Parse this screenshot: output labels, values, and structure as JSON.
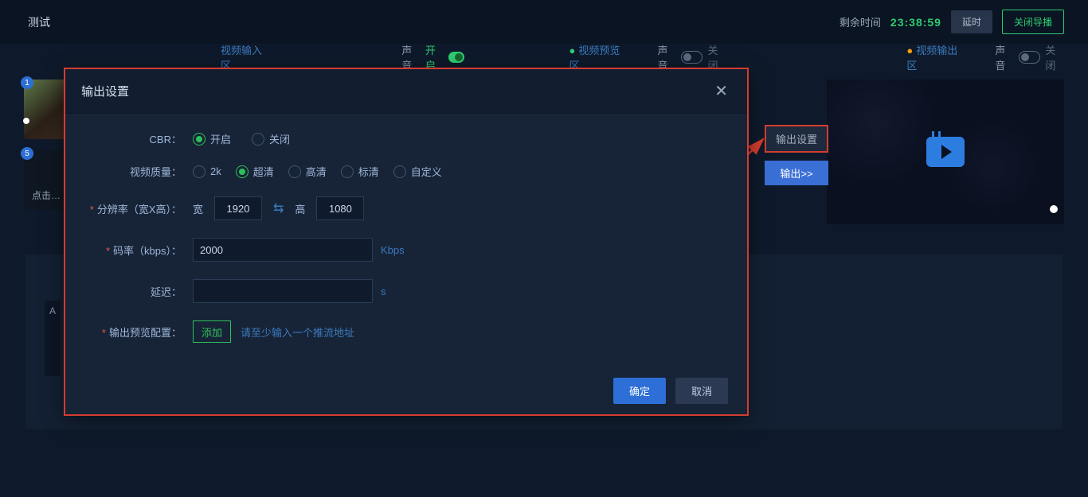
{
  "topbar": {
    "title": "测试",
    "remaining_label": "剩余时间",
    "remaining_time": "23:38:59",
    "delay_btn": "延时",
    "close_btn": "关闭导播"
  },
  "sections": {
    "input": "视频输入区",
    "sound_label": "声音",
    "on": "开启",
    "off": "关闭",
    "preview": "视频预览区",
    "output": "视频输出区"
  },
  "thumbs": {
    "n1": "1",
    "n5": "5",
    "click_label": "点击…"
  },
  "side": {
    "output_settings": "输出设置",
    "output": "输出>>"
  },
  "bottom": {
    "a": "A"
  },
  "modal": {
    "title": "输出设置",
    "cbr_label": "CBR：",
    "cbr_on": "开启",
    "cbr_off": "关闭",
    "quality_label": "视频质量：",
    "q_2k": "2k",
    "q_sup": "超清",
    "q_hd": "高清",
    "q_sd": "标清",
    "q_custom": "自定义",
    "resolution_label": "分辨率（宽X高）：",
    "width_label": "宽",
    "width_value": "1920",
    "height_label": "高",
    "height_value": "1080",
    "bitrate_label": "码率（kbps）：",
    "bitrate_value": "2000",
    "bitrate_unit": "Kbps",
    "delay_label": "延迟：",
    "delay_value": "",
    "delay_unit": "s",
    "preview_label": "输出预览配置：",
    "add_btn": "添加",
    "hint": "请至少输入一个推流地址",
    "ok": "确定",
    "cancel": "取消"
  }
}
